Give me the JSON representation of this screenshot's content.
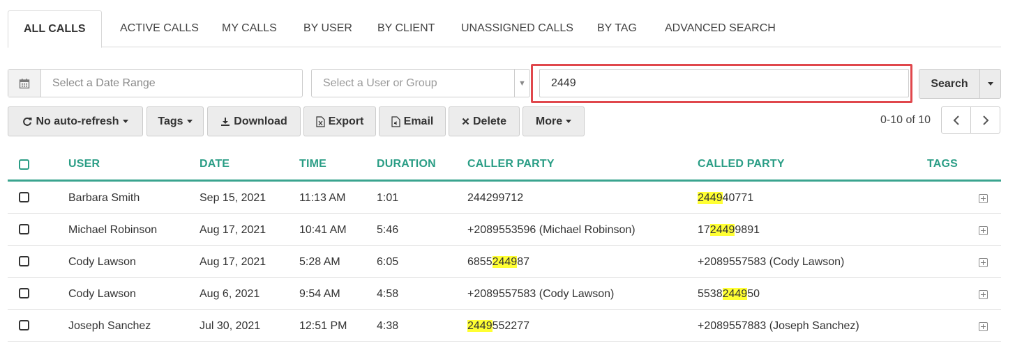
{
  "tabs": [
    {
      "label": "ALL CALLS",
      "active": true
    },
    {
      "label": "ACTIVE CALLS"
    },
    {
      "label": "MY CALLS"
    },
    {
      "label": "BY USER"
    },
    {
      "label": "BY CLIENT"
    },
    {
      "label": "UNASSIGNED CALLS"
    },
    {
      "label": "BY TAG"
    },
    {
      "label": "ADVANCED SEARCH"
    }
  ],
  "filters": {
    "date_placeholder": "Select a Date Range",
    "user_placeholder": "Select a User or Group",
    "search_value": "2449",
    "search_button": "Search"
  },
  "toolbar": {
    "refresh": "No auto-refresh",
    "tags": "Tags",
    "download": "Download",
    "export": "Export",
    "email": "Email",
    "delete": "Delete",
    "more": "More"
  },
  "pager": {
    "text": "0-10 of 10"
  },
  "table": {
    "headers": [
      "USER",
      "DATE",
      "TIME",
      "DURATION",
      "CALLER PARTY",
      "CALLED PARTY",
      "TAGS"
    ],
    "rows": [
      {
        "user": "Barbara Smith",
        "date": "Sep 15, 2021",
        "time": "11:13 AM",
        "duration": "1:01",
        "caller": [
          "244299712",
          "",
          ""
        ],
        "called": [
          "",
          "2449",
          "40771"
        ]
      },
      {
        "user": "Michael Robinson",
        "date": "Aug 17, 2021",
        "time": "10:41 AM",
        "duration": "5:46",
        "caller": [
          "+2089553596 (Michael Robinson)",
          "",
          ""
        ],
        "called": [
          "17",
          "2449",
          "9891"
        ]
      },
      {
        "user": "Cody Lawson",
        "date": "Aug 17, 2021",
        "time": "5:28 AM",
        "duration": "6:05",
        "caller": [
          "6855",
          "2449",
          "87"
        ],
        "called": [
          "+2089557583 (Cody Lawson)",
          "",
          ""
        ]
      },
      {
        "user": "Cody Lawson",
        "date": "Aug 6, 2021",
        "time": "9:54 AM",
        "duration": "4:58",
        "caller": [
          "+2089557583 (Cody Lawson)",
          "",
          ""
        ],
        "called": [
          "5538",
          "2449",
          "50"
        ]
      },
      {
        "user": "Joseph Sanchez",
        "date": "Jul 30, 2021",
        "time": "12:51 PM",
        "duration": "4:38",
        "caller": [
          "",
          "2449",
          "552277"
        ],
        "called": [
          "+2089557883 (Joseph Sanchez)",
          "",
          ""
        ]
      }
    ]
  },
  "colors": {
    "accent": "#2a9d85",
    "highlight": "#ffff33",
    "callout": "#e0474c"
  }
}
